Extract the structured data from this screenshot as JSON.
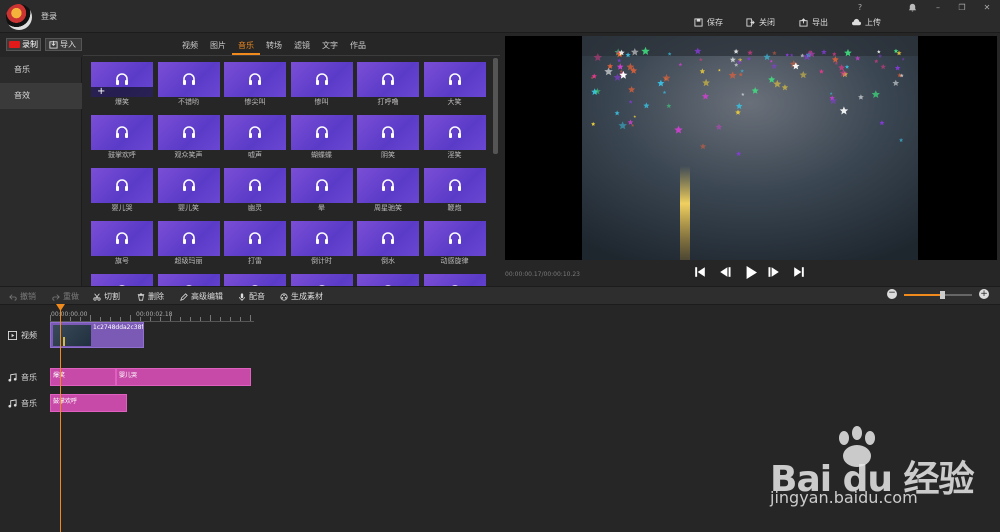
{
  "header": {
    "login_label": "登录",
    "window_controls": [
      "?",
      "🔔",
      "–",
      "❐",
      "✕"
    ],
    "buttons": [
      {
        "label": "保存",
        "icon": "save-icon"
      },
      {
        "label": "关闭",
        "icon": "exit-icon"
      },
      {
        "label": "导出",
        "icon": "export-icon"
      },
      {
        "label": "上传",
        "icon": "upload-icon"
      }
    ]
  },
  "toolbar": {
    "record_label": "录制",
    "import_label": "导入"
  },
  "tabs": [
    "视频",
    "图片",
    "音乐",
    "转场",
    "滤镜",
    "文字",
    "作品"
  ],
  "active_tab": "音乐",
  "sidebar": {
    "items": [
      "音乐",
      "音效"
    ],
    "active": "音效"
  },
  "grid": {
    "items": [
      "爆笑",
      "不错哟",
      "惨尖叫",
      "惨叫",
      "打呼噜",
      "大笑",
      "鼓掌欢呼",
      "观众笑声",
      "嘘声",
      "蝴蝶蝶",
      "阴笑",
      "淫笑",
      "婴儿哭",
      "婴儿笑",
      "幽灵",
      "晕",
      "周星驰笑",
      "鞭炮",
      "旗号",
      "超级玛丽",
      "打雷",
      "倒计时",
      "倒水",
      "动感旋律",
      "",
      "",
      "",
      "",
      "",
      ""
    ],
    "hover_add": "+"
  },
  "preview": {
    "timecode": "00:00:00.17/00:00:10.23"
  },
  "edit_toolbar": {
    "undo": "撤销",
    "redo": "重做",
    "cut": "切割",
    "delete": "删除",
    "advanced": "高级编辑",
    "dub": "配音",
    "generate": "生成素材",
    "zoom_minus": "−",
    "zoom_plus": "+",
    "zoom_level": 0.6
  },
  "timeline": {
    "ruler": [
      "00:00:00.00",
      "00:00:02.18"
    ],
    "tracks": [
      {
        "label": "视频",
        "icon": "video-track-icon",
        "clips": [
          {
            "label": "1c2748dda2c38f0"
          }
        ]
      },
      {
        "label": "音乐",
        "icon": "music-note-icon",
        "clips": [
          {
            "label": "爆笑"
          },
          {
            "label": "婴儿哭"
          }
        ]
      },
      {
        "label": "音乐",
        "icon": "music-note-icon",
        "clips": [
          {
            "label": "鼓掌欢呼"
          }
        ]
      }
    ]
  },
  "watermark": {
    "brand": "Bai du 经验",
    "url": "jingyan.baidu.com"
  },
  "colors": {
    "accent": "#f08a1c",
    "tile": "#6a47d3",
    "clip_pink": "#c84aa8",
    "record_red": "#e21a1a"
  }
}
